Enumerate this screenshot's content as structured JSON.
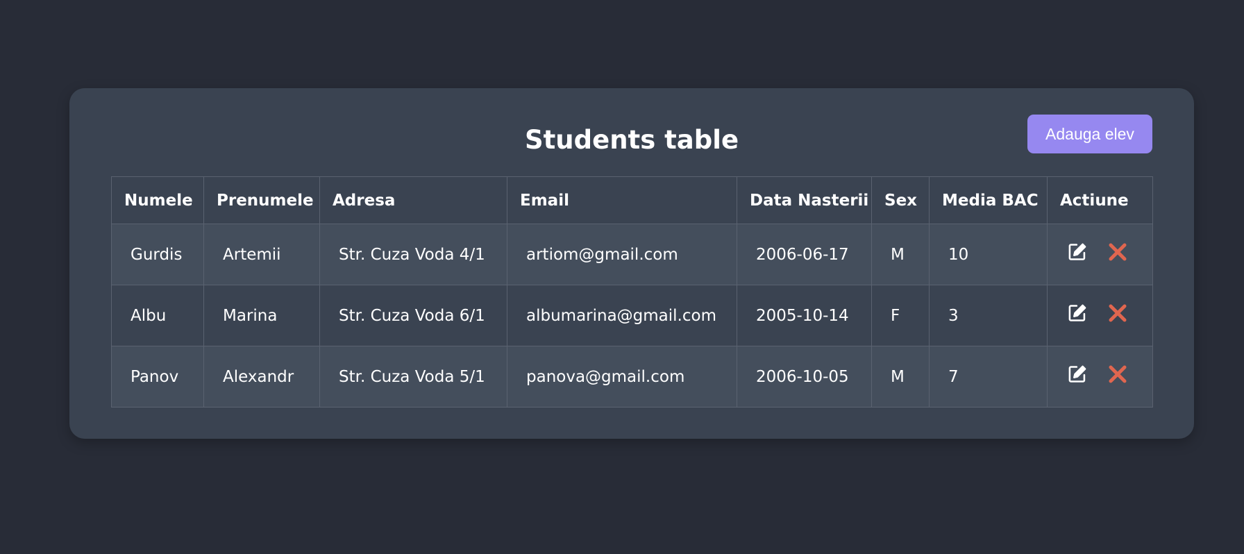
{
  "title": "Students table",
  "add_button_label": "Adauga elev",
  "columns": [
    "Numele",
    "Prenumele",
    "Adresa",
    "Email",
    "Data Nasterii",
    "Sex",
    "Media BAC",
    "Actiune"
  ],
  "rows": [
    [
      "Gurdis",
      "Artemii",
      "Str. Cuza Voda 4/1",
      "artiom@gmail.com",
      "2006-06-17",
      "M",
      "10"
    ],
    [
      "Albu",
      "Marina",
      "Str. Cuza Voda 6/1",
      "albumarina@gmail.com",
      "2005-10-14",
      "F",
      "3"
    ],
    [
      "Panov",
      "Alexandr",
      "Str. Cuza Voda 5/1",
      "panova@gmail.com",
      "2006-10-05",
      "M",
      "7"
    ]
  ],
  "icons": {
    "edit": "edit-icon",
    "delete": "delete-icon"
  },
  "colors": {
    "background": "#282c37",
    "card": "#3a4351",
    "row_alt": "#444e5c",
    "accent": "#9688f0",
    "delete": "#e0664f",
    "border": "#5a6270"
  }
}
